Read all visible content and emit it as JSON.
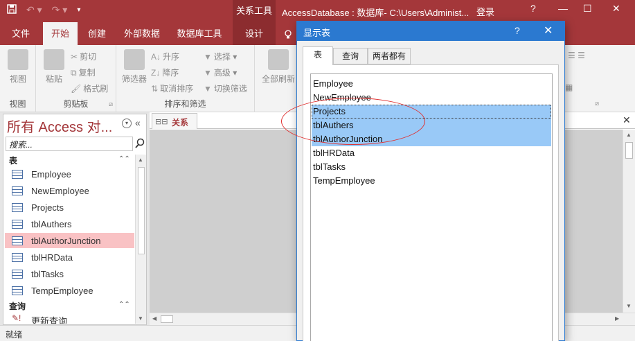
{
  "titlebar": {
    "save_icon": "save-icon",
    "undo_icon": "undo-icon",
    "redo_icon": "redo-icon",
    "context_tab": "关系工具",
    "window_title": "AccessDatabase : 数据库- C:\\Users\\Administ...",
    "login": "登录",
    "help": "?",
    "minimize": "—",
    "maximize": "☐",
    "close": "✕"
  },
  "ribbon_tabs": {
    "file": "文件",
    "home": "开始",
    "create": "创建",
    "external": "外部数据",
    "dbtools": "数据库工具",
    "design": "设计"
  },
  "ribbon": {
    "view_label": "视图",
    "view_group": "视图",
    "paste_label": "粘贴",
    "cut": "剪切",
    "copy": "复制",
    "format_painter": "格式刷",
    "clipboard_group": "剪贴板",
    "filter_label": "筛选器",
    "ascending": "升序",
    "descending": "降序",
    "remove_sort": "取消排序",
    "selection": "选择",
    "advanced": "高级",
    "toggle_filter": "切换筛选",
    "sort_group": "排序和筛选",
    "refresh_label": "全部刷新"
  },
  "nav": {
    "title": "所有 Access 对...",
    "search_placeholder": "搜索...",
    "group_tables": "表",
    "group_queries": "查询",
    "tables": [
      "Employee",
      "NewEmployee",
      "Projects",
      "tblAuthers",
      "tblAuthorJunction",
      "tblHRData",
      "tblTasks",
      "TempEmployee"
    ],
    "queries": [
      "更新查询"
    ]
  },
  "doc": {
    "tab_label": "关系"
  },
  "status": {
    "text": "就绪"
  },
  "dialog": {
    "title": "显示表",
    "help": "?",
    "close": "✕",
    "tabs": [
      "表",
      "查询",
      "两者都有"
    ],
    "items": [
      "Employee",
      "NewEmployee",
      "Projects",
      "tblAuthers",
      "tblAuthorJunction",
      "tblHRData",
      "tblTasks",
      "TempEmployee"
    ]
  },
  "colors": {
    "accent": "#a4373a",
    "dialog_blue": "#2b79d0",
    "selection_blue": "#99c9f7",
    "nav_selection": "#f9c2c4",
    "annotation_red": "#e03030"
  }
}
